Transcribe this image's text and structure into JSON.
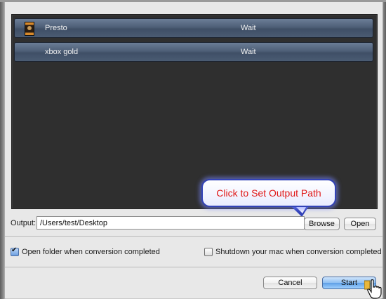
{
  "tasks": [
    {
      "name": "Presto",
      "status": "Wait",
      "has_thumbnail": true
    },
    {
      "name": "xbox gold",
      "status": "Wait",
      "has_thumbnail": false
    }
  ],
  "callout": {
    "text": "Click to Set Output Path"
  },
  "output": {
    "label": "Output:",
    "path": "/Users/test/Desktop",
    "browse_label": "Browse",
    "open_label": "Open"
  },
  "options": {
    "open_folder_label": "Open folder when conversion completed",
    "open_folder_checked": true,
    "shutdown_label": "Shutdown your mac when conversion completed",
    "shutdown_checked": false
  },
  "footer": {
    "cancel_label": "Cancel",
    "start_label": "Start"
  },
  "colors": {
    "callout_text": "#e01818",
    "callout_border": "#3343b8",
    "list_bg": "#2f2f2f"
  },
  "icons": {
    "cursor": "hand-pointer-icon",
    "thumbnail": "video-thumbnail-icon"
  }
}
